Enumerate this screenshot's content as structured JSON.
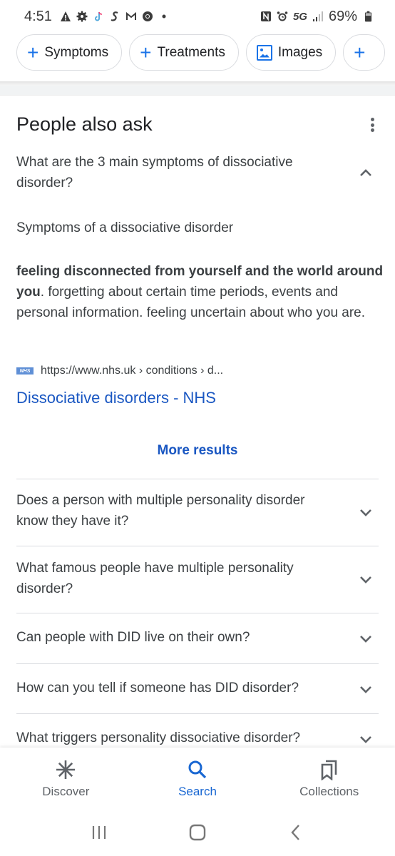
{
  "status_bar": {
    "time": "4:51",
    "left_icons": [
      "warning-icon",
      "settings-icon",
      "tiktok-icon",
      "app-s-icon",
      "gmail-icon",
      "chrome-icon",
      "dot-icon"
    ],
    "right_icons": [
      "nfc-icon",
      "alarm-icon",
      "5g-icon",
      "signal-icon"
    ],
    "network": "5G",
    "battery_percent": "69%"
  },
  "chips": [
    {
      "label": "Symptoms",
      "icon": "plus-icon"
    },
    {
      "label": "Treatments",
      "icon": "plus-icon"
    },
    {
      "label": "Images",
      "icon": "image-icon"
    },
    {
      "label": "",
      "icon": "plus-icon"
    }
  ],
  "paa": {
    "title": "People also ask",
    "expanded": {
      "question": "What are the 3 main symptoms of dissociative disorder?",
      "answer_heading": "Symptoms of a dissociative disorder",
      "answer_bold": "feeling disconnected from yourself and the world around you",
      "answer_rest": ". forgetting about certain time periods, events and personal information. feeling uncertain about who you are.",
      "source_url": "https://www.nhs.uk › conditions › d...",
      "source_logo": "NHS",
      "source_title": "Dissociative disorders - NHS",
      "more_results": "More results"
    },
    "questions": [
      "Does a person with multiple personality disorder know they have it?",
      "What famous people have multiple personality disorder?",
      "Can people with DID live on their own?",
      "How can you tell if someone has DID disorder?",
      "What triggers personality dissociative disorder?"
    ]
  },
  "bottom_nav": [
    {
      "label": "Discover",
      "icon": "discover-asterisk-icon",
      "active": false
    },
    {
      "label": "Search",
      "icon": "search-icon",
      "active": true
    },
    {
      "label": "Collections",
      "icon": "collections-bookmark-icon",
      "active": false
    }
  ],
  "colors": {
    "accent": "#1a73e8",
    "link": "#1a57c2",
    "text": "#3c4043",
    "divider": "#dadce0"
  }
}
